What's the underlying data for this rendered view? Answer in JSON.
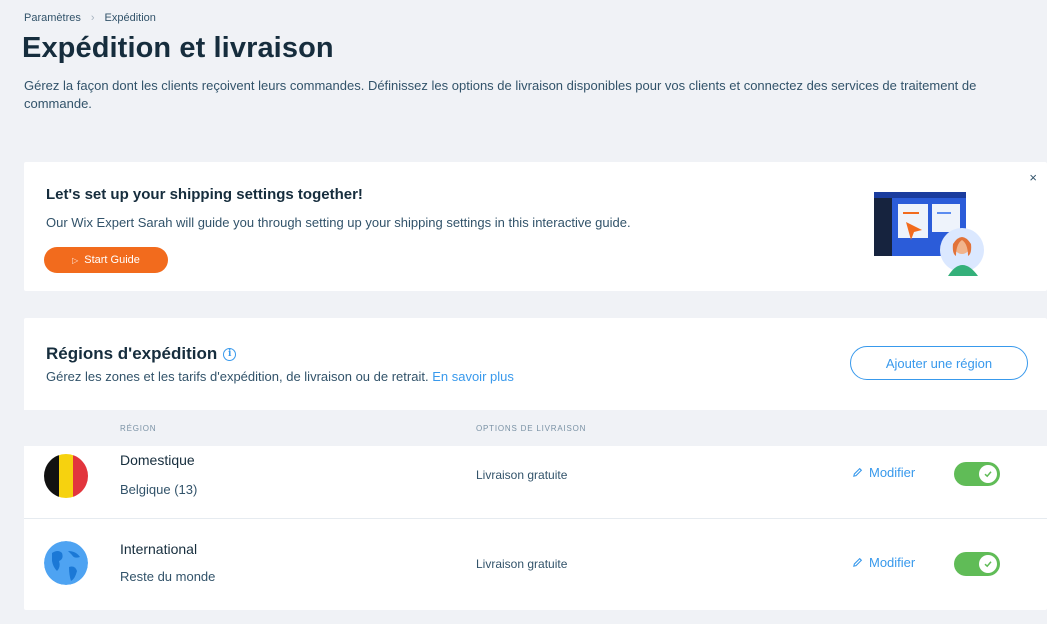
{
  "breadcrumb": {
    "parent": "Paramètres",
    "current": "Expédition"
  },
  "header": {
    "title": "Expédition et livraison",
    "description": "Gérez la façon dont les clients reçoivent leurs commandes. Définissez les options de livraison disponibles pour vos clients et connectez des services de traitement de commande."
  },
  "guide": {
    "title": "Let's set up your shipping settings together!",
    "text": "Our Wix Expert Sarah will guide you through setting up your shipping settings in this interactive guide.",
    "button_label": "Start Guide",
    "close_label": "×"
  },
  "regions": {
    "title": "Régions d'expédition",
    "description": "Gérez les zones et les tarifs d'expédition, de livraison ou de retrait.",
    "learn_more": "En savoir plus",
    "add_button": "Ajouter une région",
    "columns": {
      "region": "RÉGION",
      "options": "OPTIONS DE LIVRAISON"
    },
    "rows": [
      {
        "name": "Domestique",
        "sub": "Belgique (13)",
        "option": "Livraison gratuite",
        "edit": "Modifier",
        "enabled": true,
        "icon": "belgium-flag-icon"
      },
      {
        "name": "International",
        "sub": "Reste du monde",
        "option": "Livraison gratuite",
        "edit": "Modifier",
        "enabled": true,
        "icon": "globe-icon"
      }
    ]
  },
  "colors": {
    "accent": "#3899ec",
    "cta": "#f26b1d",
    "toggle_on": "#60bc57",
    "background": "#f0f2f6"
  }
}
